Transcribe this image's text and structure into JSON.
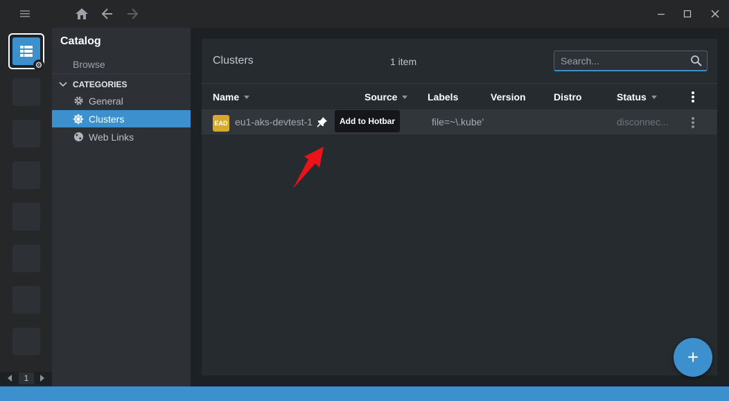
{
  "titlebar": {
    "menu_icon": "hamburger-icon",
    "home_icon": "home-icon",
    "back_icon": "arrow-left-icon",
    "forward_icon": "arrow-right-icon",
    "minimize_icon": "minimize-icon",
    "maximize_icon": "maximize-icon",
    "close_icon": "close-icon"
  },
  "hotbar": {
    "catalog_icon": "catalog-icon",
    "page_number": "1",
    "empty_slots": 7
  },
  "sidebar": {
    "title": "Catalog",
    "browse_label": "Browse",
    "categories_label": "CATEGORIES",
    "items": [
      {
        "label": "General",
        "icon": "gear-icon",
        "active": false
      },
      {
        "label": "Clusters",
        "icon": "helm-icon",
        "active": true
      },
      {
        "label": "Web Links",
        "icon": "globe-icon",
        "active": false
      }
    ]
  },
  "main": {
    "title": "Clusters",
    "count": "1 item",
    "search": {
      "placeholder": "Search..."
    },
    "columns": [
      "Name",
      "Source",
      "Labels",
      "Version",
      "Distro",
      "Status"
    ],
    "rows": [
      {
        "avatar": "EAD",
        "name": "eu1-aks-devtest-1",
        "labels": "file=~\\.kube'",
        "status": "disconnec..."
      }
    ],
    "tooltip": "Add to Hotbar",
    "fab_label": "+"
  },
  "colors": {
    "accent": "#3d90ce",
    "avatar": "#d6aa2c",
    "annotation": "#e8141a"
  }
}
